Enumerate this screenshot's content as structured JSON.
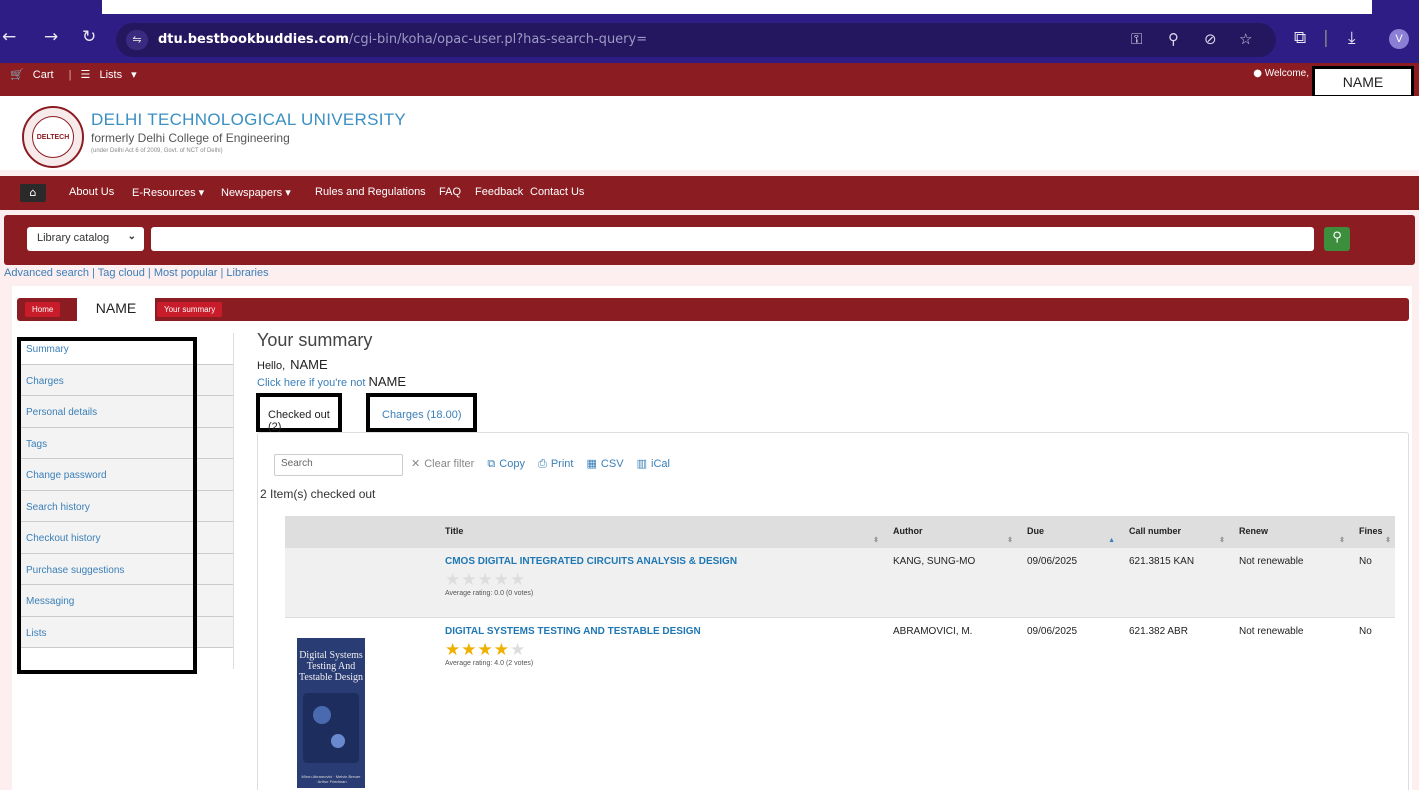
{
  "browser": {
    "url_host": "dtu.bestbookbuddies.com",
    "url_path": "/cgi-bin/koha/opac-user.pl?has-search-query=",
    "profile_initial": "V"
  },
  "userbar": {
    "cart": "Cart",
    "lists": "Lists",
    "welcome": "Welcome,",
    "name": "NAME"
  },
  "header": {
    "title": "DELHI TECHNOLOGICAL UNIVERSITY",
    "subtitle": "formerly Delhi College of Engineering",
    "note": "(under Delhi Act 6 of 2009, Govt. of NCT of Delhi)",
    "logo_text": "DELTECH"
  },
  "mainnav": {
    "items": [
      "About Us",
      "E-Resources ▾",
      "Newspapers ▾",
      "Rules and Regulations",
      "FAQ",
      "Feedback",
      "Contact Us"
    ]
  },
  "search": {
    "scope": "Library catalog",
    "query": ""
  },
  "links": "Advanced search | Tag cloud | Most popular | Libraries",
  "breadcrumb": {
    "home": "Home",
    "name": "NAME",
    "current": "Your summary"
  },
  "sidebar": {
    "items": [
      "Summary",
      "Charges",
      "Personal details",
      "Tags",
      "Change password",
      "Search history",
      "Checkout history",
      "Purchase suggestions",
      "Messaging",
      "Lists"
    ]
  },
  "main": {
    "title": "Your summary",
    "hello": "Hello,",
    "name": "NAME",
    "not_you": "Click here if you're not",
    "tabs": [
      "Checked out (2)",
      "Charges (18.00)"
    ],
    "filter_placeholder": "Search",
    "tools": {
      "clear": "Clear filter",
      "copy": "Copy",
      "print": "Print",
      "csv": "CSV",
      "ical": "iCal"
    },
    "count": "2 Item(s) checked out",
    "columns": [
      "Title",
      "Author",
      "Due",
      "Call number",
      "Renew",
      "Fines"
    ],
    "rows": [
      {
        "title": "CMOS DIGITAL INTEGRATED CIRCUITS ANALYSIS & DESIGN",
        "rating": 0,
        "rating_text": "Average rating: 0.0 (0 votes)",
        "author": "KANG, SUNG-MO",
        "due": "09/06/2025",
        "call": "621.3815 KAN",
        "renew": "Not renewable",
        "fines": "No"
      },
      {
        "title": "DIGITAL SYSTEMS TESTING AND TESTABLE DESIGN",
        "rating": 4,
        "rating_text": "Average rating: 4.0 (2 votes)",
        "author": "ABRAMOVICI, M.",
        "due": "09/06/2025",
        "call": "621.382 ABR",
        "renew": "Not renewable",
        "fines": "No",
        "cover_title": "Digital Systems Testing And Testable Design",
        "cover_authors": "Miron Abramovici · Melvin Breuer · Arthur Friedman"
      }
    ]
  },
  "colors": {
    "brand": "#8b1c22",
    "link": "#3a7fb8",
    "chrome": "#2f1d86"
  }
}
